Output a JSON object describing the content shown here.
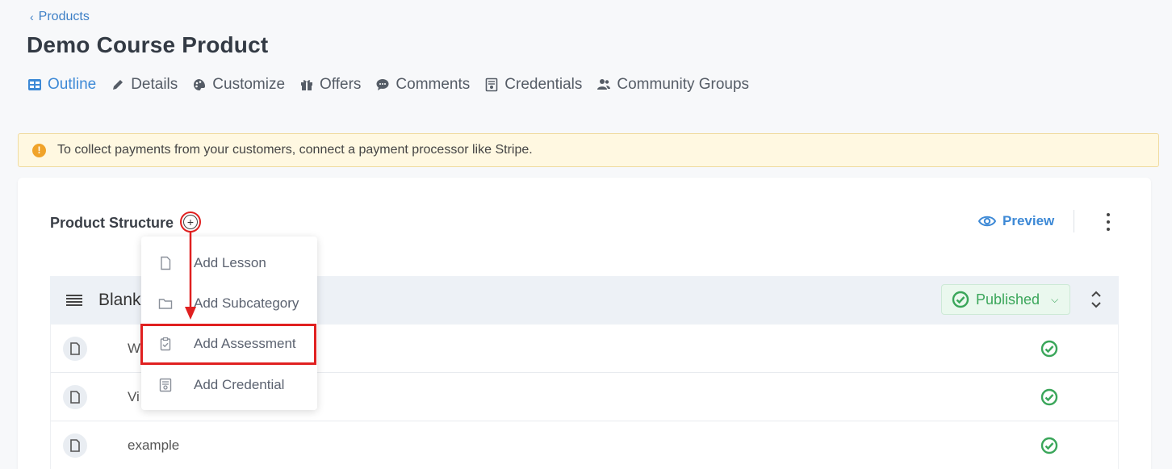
{
  "breadcrumb": {
    "label": "Products"
  },
  "page": {
    "title": "Demo Course Product"
  },
  "tabs": [
    {
      "label": "Outline",
      "icon": "outline-icon",
      "active": true
    },
    {
      "label": "Details",
      "icon": "pencil-icon"
    },
    {
      "label": "Customize",
      "icon": "palette-icon"
    },
    {
      "label": "Offers",
      "icon": "gift-icon"
    },
    {
      "label": "Comments",
      "icon": "comment-icon"
    },
    {
      "label": "Credentials",
      "icon": "certificate-icon"
    },
    {
      "label": "Community Groups",
      "icon": "users-icon"
    }
  ],
  "alert": {
    "text": "To collect payments from your customers, connect a payment processor like Stripe.",
    "icon": "warning-icon"
  },
  "structure": {
    "title": "Product Structure",
    "preview_label": "Preview"
  },
  "section": {
    "name": "Blank",
    "status": "Published"
  },
  "rows": [
    {
      "title": "W"
    },
    {
      "title": "Vi"
    },
    {
      "title": "example"
    }
  ],
  "menu": {
    "items": [
      {
        "label": "Add Lesson",
        "icon": "document-icon"
      },
      {
        "label": "Add Subcategory",
        "icon": "folder-icon"
      },
      {
        "label": "Add Assessment",
        "icon": "clipboard-check-icon"
      },
      {
        "label": "Add Credential",
        "icon": "certificate-icon"
      }
    ]
  },
  "colors": {
    "accent": "#3d89d6",
    "success": "#3aa65a",
    "annotation": "#e02020",
    "warning": "#f0a32a"
  }
}
